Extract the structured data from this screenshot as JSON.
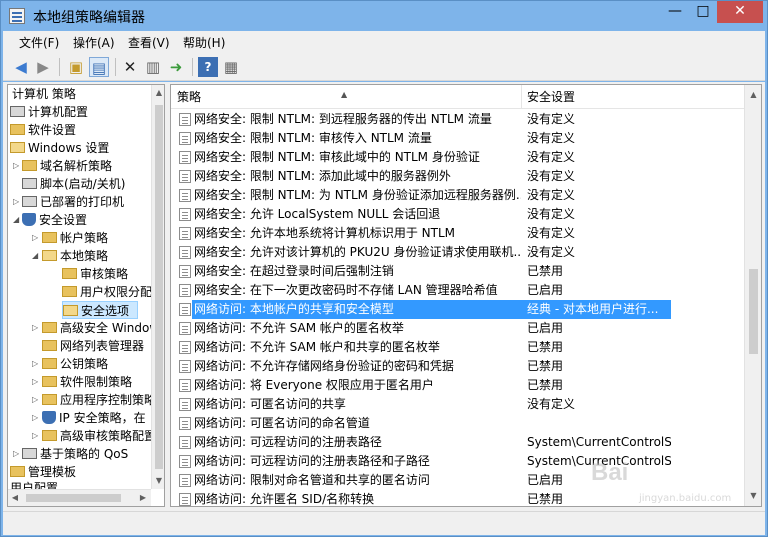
{
  "window": {
    "title": "本地组策略编辑器"
  },
  "controls": {
    "minimize": "—",
    "maximize": "□",
    "close": "✕"
  },
  "menu": [
    "文件(F)",
    "操作(A)",
    "查看(V)",
    "帮助(H)"
  ],
  "toolbar_icons": [
    "back-arrow-icon",
    "forward-arrow-icon",
    "up-folder-icon",
    "show-tree-icon",
    "delete-icon",
    "properties-icon",
    "export-icon",
    "help-icon",
    "view-icon"
  ],
  "tree": [
    {
      "label": "计算机 策略",
      "level": 0
    },
    {
      "label": "计算机配置",
      "level": 0
    },
    {
      "label": "软件设置",
      "level": 1
    },
    {
      "label": "Windows 设置",
      "level": 1
    },
    {
      "label": "域名解析策略",
      "level": 2
    },
    {
      "label": "脚本(启动/关机)",
      "level": 2
    },
    {
      "label": "已部署的打印机",
      "level": 2
    },
    {
      "label": "安全设置",
      "level": 2
    },
    {
      "label": "帐户策略",
      "level": 3
    },
    {
      "label": "本地策略",
      "level": 3
    },
    {
      "label": "审核策略",
      "level": 4
    },
    {
      "label": "用户权限分配",
      "level": 4
    },
    {
      "label": "安全选项",
      "level": 4
    },
    {
      "label": "高级安全 Windows",
      "level": 3
    },
    {
      "label": "网络列表管理器",
      "level": 3
    },
    {
      "label": "公钥策略",
      "level": 3
    },
    {
      "label": "软件限制策略",
      "level": 3
    },
    {
      "label": "应用程序控制策略",
      "level": 3
    },
    {
      "label": "IP 安全策略，在",
      "level": 3
    },
    {
      "label": "高级审核策略配置",
      "level": 3
    },
    {
      "label": "基于策略的 QoS",
      "level": 2
    },
    {
      "label": "管理模板",
      "level": 1
    },
    {
      "label": "用户配置",
      "level": 0
    }
  ],
  "list": {
    "headers": {
      "policy": "策略",
      "setting": "安全设置"
    },
    "rows": [
      {
        "name": "网络安全: 限制 NTLM: 到远程服务器的传出 NTLM 流量",
        "value": "没有定义"
      },
      {
        "name": "网络安全: 限制 NTLM: 审核传入 NTLM 流量",
        "value": "没有定义"
      },
      {
        "name": "网络安全: 限制 NTLM: 审核此域中的 NTLM 身份验证",
        "value": "没有定义"
      },
      {
        "name": "网络安全: 限制 NTLM: 添加此域中的服务器例外",
        "value": "没有定义"
      },
      {
        "name": "网络安全: 限制 NTLM: 为 NTLM 身份验证添加远程服务器例...",
        "value": "没有定义"
      },
      {
        "name": "网络安全: 允许 LocalSystem NULL 会话回退",
        "value": "没有定义"
      },
      {
        "name": "网络安全: 允许本地系统将计算机标识用于 NTLM",
        "value": "没有定义"
      },
      {
        "name": "网络安全: 允许对该计算机的 PKU2U 身份验证请求使用联机...",
        "value": "没有定义"
      },
      {
        "name": "网络安全: 在超过登录时间后强制注销",
        "value": "已禁用"
      },
      {
        "name": "网络安全: 在下一次更改密码时不存储 LAN 管理器哈希值",
        "value": "已启用"
      },
      {
        "name": "网络访问: 本地帐户的共享和安全模型",
        "value": "经典 - 对本地用户进行..."
      },
      {
        "name": "网络访问: 不允许 SAM 帐户的匿名枚举",
        "value": "已启用"
      },
      {
        "name": "网络访问: 不允许 SAM 帐户和共享的匿名枚举",
        "value": "已禁用"
      },
      {
        "name": "网络访问: 不允许存储网络身份验证的密码和凭据",
        "value": "已禁用"
      },
      {
        "name": "网络访问: 将 Everyone 权限应用于匿名用户",
        "value": "已禁用"
      },
      {
        "name": "网络访问: 可匿名访问的共享",
        "value": "没有定义"
      },
      {
        "name": "网络访问: 可匿名访问的命名管道",
        "value": ""
      },
      {
        "name": "网络访问: 可远程访问的注册表路径",
        "value": "System\\CurrentControlS..."
      },
      {
        "name": "网络访问: 可远程访问的注册表路径和子路径",
        "value": "System\\CurrentControlS..."
      },
      {
        "name": "网络访问: 限制对命名管道和共享的匿名访问",
        "value": "已启用"
      },
      {
        "name": "网络访问: 允许匿名 SID/名称转换",
        "value": "已禁用"
      }
    ],
    "selected_index": 10
  },
  "watermark": {
    "brand": "Bai",
    "url": "jingyan.baidu.com"
  }
}
